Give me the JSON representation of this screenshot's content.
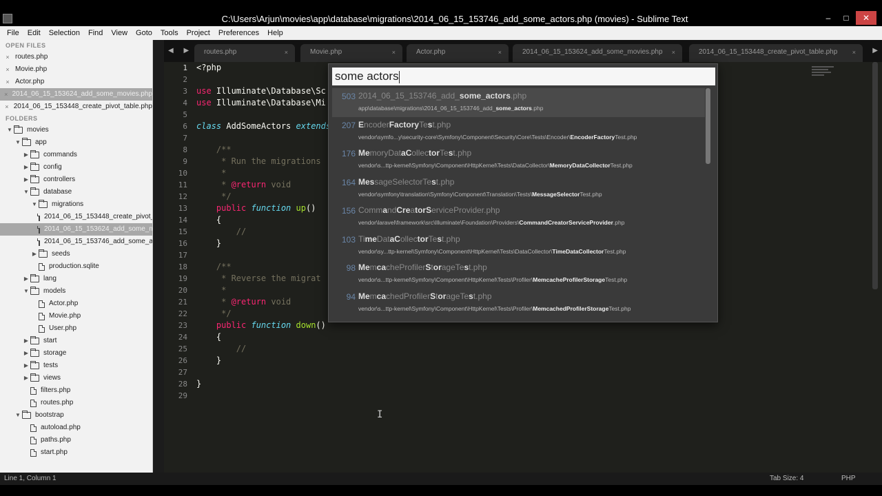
{
  "window": {
    "title": "C:\\Users\\Arjun\\movies\\app\\database\\migrations\\2014_06_15_153746_add_some_actors.php (movies) - Sublime Text",
    "minimize": "–",
    "maximize": "□",
    "close": "✕"
  },
  "menu": [
    "File",
    "Edit",
    "Selection",
    "Find",
    "View",
    "Goto",
    "Tools",
    "Project",
    "Preferences",
    "Help"
  ],
  "sidebar": {
    "open_files_header": "OPEN FILES",
    "open_files": [
      "routes.php",
      "Movie.php",
      "Actor.php",
      "2014_06_15_153624_add_some_movies.php",
      "2014_06_15_153448_create_pivot_table.php"
    ],
    "folders_header": "FOLDERS",
    "tree": [
      {
        "label": "movies",
        "type": "folder",
        "open": true,
        "depth": 0
      },
      {
        "label": "app",
        "type": "folder",
        "open": true,
        "depth": 1
      },
      {
        "label": "commands",
        "type": "folder",
        "open": false,
        "depth": 2
      },
      {
        "label": "config",
        "type": "folder",
        "open": false,
        "depth": 2
      },
      {
        "label": "controllers",
        "type": "folder",
        "open": false,
        "depth": 2
      },
      {
        "label": "database",
        "type": "folder",
        "open": true,
        "depth": 2
      },
      {
        "label": "migrations",
        "type": "folder",
        "open": true,
        "depth": 3
      },
      {
        "label": "2014_06_15_153448_create_pivot_table.php",
        "type": "file",
        "depth": 4
      },
      {
        "label": "2014_06_15_153624_add_some_movies.php",
        "type": "file",
        "depth": 4,
        "selected": true
      },
      {
        "label": "2014_06_15_153746_add_some_actors.php",
        "type": "file",
        "depth": 4
      },
      {
        "label": "seeds",
        "type": "folder",
        "open": false,
        "depth": 3
      },
      {
        "label": "production.sqlite",
        "type": "file",
        "depth": 3
      },
      {
        "label": "lang",
        "type": "folder",
        "open": false,
        "depth": 2
      },
      {
        "label": "models",
        "type": "folder",
        "open": true,
        "depth": 2
      },
      {
        "label": "Actor.php",
        "type": "file",
        "depth": 3
      },
      {
        "label": "Movie.php",
        "type": "file",
        "depth": 3
      },
      {
        "label": "User.php",
        "type": "file",
        "depth": 3
      },
      {
        "label": "start",
        "type": "folder",
        "open": false,
        "depth": 2
      },
      {
        "label": "storage",
        "type": "folder",
        "open": false,
        "depth": 2
      },
      {
        "label": "tests",
        "type": "folder",
        "open": false,
        "depth": 2
      },
      {
        "label": "views",
        "type": "folder",
        "open": false,
        "depth": 2
      },
      {
        "label": "filters.php",
        "type": "file",
        "depth": 2
      },
      {
        "label": "routes.php",
        "type": "file",
        "depth": 2
      },
      {
        "label": "bootstrap",
        "type": "folder",
        "open": true,
        "depth": 1
      },
      {
        "label": "autoload.php",
        "type": "file",
        "depth": 2
      },
      {
        "label": "paths.php",
        "type": "file",
        "depth": 2
      },
      {
        "label": "start.php",
        "type": "file",
        "depth": 2
      }
    ]
  },
  "tabs": [
    {
      "label": "routes.php"
    },
    {
      "label": "Movie.php"
    },
    {
      "label": "Actor.php"
    },
    {
      "label": "2014_06_15_153624_add_some_movies.php"
    },
    {
      "label": "2014_06_15_153448_create_pivot_table.php"
    }
  ],
  "tab_nav": "◀ ▶",
  "tab_close": "×",
  "editor": {
    "line_numbers": [
      "1",
      "2",
      "3",
      "4",
      "5",
      "6",
      "7",
      "8",
      "9",
      "10",
      "11",
      "12",
      "13",
      "14",
      "15",
      "16",
      "17",
      "18",
      "19",
      "20",
      "21",
      "22",
      "23",
      "24",
      "25",
      "26",
      "27",
      "28",
      "29"
    ],
    "lines": [
      [
        {
          "t": "<?php",
          "c": "plain"
        }
      ],
      [],
      [
        {
          "t": "use ",
          "c": "kw"
        },
        {
          "t": "Illuminate\\Database\\Sc",
          "c": "plain"
        }
      ],
      [
        {
          "t": "use ",
          "c": "kw"
        },
        {
          "t": "Illuminate\\Database\\Mi",
          "c": "plain"
        }
      ],
      [],
      [
        {
          "t": "class ",
          "c": "kw2"
        },
        {
          "t": "AddSomeActors ",
          "c": "plain"
        },
        {
          "t": "extends",
          "c": "kw2"
        }
      ],
      [],
      [
        {
          "t": "    /**",
          "c": "cm"
        }
      ],
      [
        {
          "t": "     * Run the migrations",
          "c": "cm"
        }
      ],
      [
        {
          "t": "     *",
          "c": "cm"
        }
      ],
      [
        {
          "t": "     * ",
          "c": "cm"
        },
        {
          "t": "@return",
          "c": "cmtag"
        },
        {
          "t": " void",
          "c": "cm"
        }
      ],
      [
        {
          "t": "     */",
          "c": "cm"
        }
      ],
      [
        {
          "t": "    public ",
          "c": "kw"
        },
        {
          "t": "function ",
          "c": "kw2"
        },
        {
          "t": "up",
          "c": "fn"
        },
        {
          "t": "()",
          "c": "plain"
        }
      ],
      [
        {
          "t": "    {",
          "c": "plain"
        }
      ],
      [
        {
          "t": "        //",
          "c": "cm"
        }
      ],
      [
        {
          "t": "    }",
          "c": "plain"
        }
      ],
      [],
      [
        {
          "t": "    /**",
          "c": "cm"
        }
      ],
      [
        {
          "t": "     * Reverse the migrat",
          "c": "cm"
        }
      ],
      [
        {
          "t": "     *",
          "c": "cm"
        }
      ],
      [
        {
          "t": "     * ",
          "c": "cm"
        },
        {
          "t": "@return",
          "c": "cmtag"
        },
        {
          "t": " void",
          "c": "cm"
        }
      ],
      [
        {
          "t": "     */",
          "c": "cm"
        }
      ],
      [
        {
          "t": "    public ",
          "c": "kw"
        },
        {
          "t": "function ",
          "c": "kw2"
        },
        {
          "t": "down",
          "c": "fn"
        },
        {
          "t": "()",
          "c": "plain"
        }
      ],
      [
        {
          "t": "    {",
          "c": "plain"
        }
      ],
      [
        {
          "t": "        //",
          "c": "cm"
        }
      ],
      [
        {
          "t": "    }",
          "c": "plain"
        }
      ],
      [],
      [
        {
          "t": "}",
          "c": "plain"
        }
      ],
      []
    ]
  },
  "goto": {
    "query": "some actors",
    "results": [
      {
        "score": "503",
        "name": [
          [
            "2014_06_15_153746_add_",
            0
          ],
          [
            "some_actors",
            1
          ],
          [
            ".php",
            0
          ]
        ],
        "path": [
          [
            "app\\database\\migrations\\2014_06_15_153746_add_",
            0
          ],
          [
            "some_actors",
            1
          ],
          [
            ".php",
            0
          ]
        ],
        "selected": true
      },
      {
        "score": "207",
        "name": [
          [
            "E",
            1
          ],
          [
            "ncoder",
            0
          ],
          [
            "Factory",
            1
          ],
          [
            "Te",
            0
          ],
          [
            "s",
            1
          ],
          [
            "t.php",
            0
          ]
        ],
        "path": [
          [
            "vendor\\symfo...y\\security-core\\Symfony\\Component\\Security\\Core\\Tests\\Encoder\\",
            0
          ],
          [
            "EncoderFactory",
            1
          ],
          [
            "Test.php",
            0
          ]
        ]
      },
      {
        "score": "176",
        "name": [
          [
            "Me",
            1
          ],
          [
            "moryDat",
            0
          ],
          [
            "aC",
            1
          ],
          [
            "ollec",
            0
          ],
          [
            "tor",
            1
          ],
          [
            "Te",
            0
          ],
          [
            "s",
            1
          ],
          [
            "t.php",
            0
          ]
        ],
        "path": [
          [
            "vendor\\s...ttp-kernel\\Symfony\\Component\\HttpKernel\\Tests\\DataCollector\\",
            0
          ],
          [
            "MemoryDataCollector",
            1
          ],
          [
            "Test.php",
            0
          ]
        ]
      },
      {
        "score": "164",
        "name": [
          [
            "Me",
            1
          ],
          [
            "s",
            1
          ],
          [
            "sageSelector",
            0
          ],
          [
            "Te",
            0
          ],
          [
            "s",
            1
          ],
          [
            "t.php",
            0
          ]
        ],
        "path": [
          [
            "vendor\\symfony\\translation\\Symfony\\Component\\Translation\\Tests\\",
            0
          ],
          [
            "MessageSelector",
            1
          ],
          [
            "Test.php",
            0
          ]
        ]
      },
      {
        "score": "156",
        "name": [
          [
            "Comm",
            0
          ],
          [
            "a",
            1
          ],
          [
            "nd",
            0
          ],
          [
            "Cre",
            1
          ],
          [
            "a",
            0
          ],
          [
            "torS",
            1
          ],
          [
            "erviceProvider.php",
            0
          ]
        ],
        "path": [
          [
            "vendor\\laravel\\framework\\src\\Illuminate\\Foundation\\Providers\\",
            0
          ],
          [
            "CommandCreatorServiceProvider",
            1
          ],
          [
            ".php",
            0
          ]
        ]
      },
      {
        "score": "103",
        "name": [
          [
            "Ti",
            0
          ],
          [
            "me",
            1
          ],
          [
            "Dat",
            0
          ],
          [
            "aC",
            1
          ],
          [
            "ollec",
            0
          ],
          [
            "tor",
            1
          ],
          [
            "Te",
            0
          ],
          [
            "s",
            1
          ],
          [
            "t.php",
            0
          ]
        ],
        "path": [
          [
            "vendor\\sy...ttp-kernel\\Symfony\\Component\\HttpKernel\\Tests\\DataCollector\\",
            0
          ],
          [
            "TimeDataCollector",
            1
          ],
          [
            "Test.php",
            0
          ]
        ]
      },
      {
        "score": "98",
        "name": [
          [
            "Me",
            1
          ],
          [
            "m",
            0
          ],
          [
            "ca",
            1
          ],
          [
            "cheProfiler",
            0
          ],
          [
            "S",
            1
          ],
          [
            "t",
            0
          ],
          [
            "or",
            1
          ],
          [
            "ageTe",
            0
          ],
          [
            "s",
            1
          ],
          [
            "t.php",
            0
          ]
        ],
        "path": [
          [
            "vendor\\s...ttp-kernel\\Symfony\\Component\\HttpKernel\\Tests\\Profiler\\",
            0
          ],
          [
            "MemcacheProfilerStorage",
            1
          ],
          [
            "Test.php",
            0
          ]
        ]
      },
      {
        "score": "94",
        "name": [
          [
            "Me",
            1
          ],
          [
            "m",
            0
          ],
          [
            "ca",
            1
          ],
          [
            "chedProfiler",
            0
          ],
          [
            "S",
            1
          ],
          [
            "t",
            0
          ],
          [
            "or",
            1
          ],
          [
            "ageTe",
            0
          ],
          [
            "s",
            1
          ],
          [
            "t.php",
            0
          ]
        ],
        "path": [
          [
            "vendor\\s...ttp-kernel\\Symfony\\Component\\HttpKernel\\Tests\\Profiler\\",
            0
          ],
          [
            "MemcachedProfilerStorage",
            1
          ],
          [
            "Test.php",
            0
          ]
        ]
      }
    ]
  },
  "cursor": "I",
  "status": {
    "position": "Line 1, Column 1",
    "tab_size": "Tab Size: 4",
    "syntax": "PHP"
  },
  "icons": {
    "close": "close-icon",
    "folder": "folder-icon",
    "file": "file-icon",
    "arrow_open": "▼",
    "arrow_closed": "▶"
  }
}
